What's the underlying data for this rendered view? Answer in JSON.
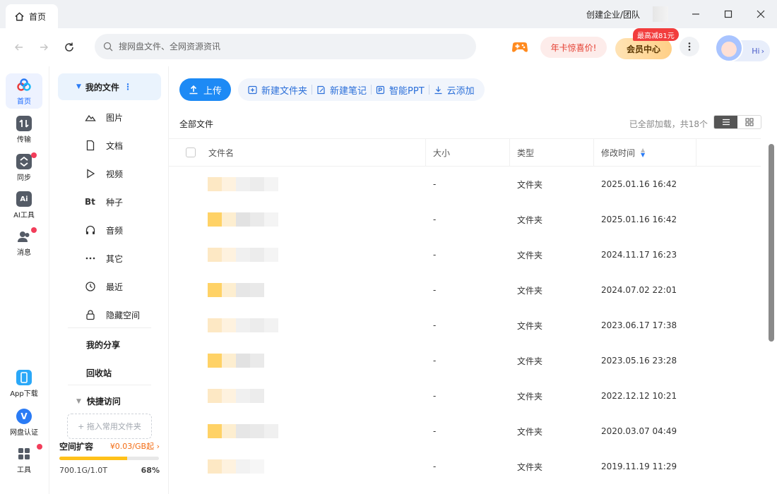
{
  "tab": {
    "title": "首页"
  },
  "titlebar": {
    "enterprise_label": "创建企业/团队"
  },
  "search": {
    "placeholder": "搜网盘文件、全网资源资讯"
  },
  "header": {
    "promo_label": "年卡惊喜价!",
    "vip_label": "会员中心",
    "vip_badge": "最高减81元",
    "hi_label": "Hi"
  },
  "rail": {
    "items": [
      {
        "label": "首页"
      },
      {
        "label": "传输"
      },
      {
        "label": "同步"
      },
      {
        "label": "AI工具"
      },
      {
        "label": "消息"
      }
    ],
    "bottom": [
      {
        "label": "App下载"
      },
      {
        "label": "网盘认证"
      },
      {
        "label": "工具"
      }
    ]
  },
  "categories": {
    "header": "我的文件",
    "items": [
      {
        "label": "图片",
        "icon": "image-icon"
      },
      {
        "label": "文档",
        "icon": "document-icon"
      },
      {
        "label": "视频",
        "icon": "play-icon"
      },
      {
        "label": "种子",
        "icon": "torrent-icon"
      },
      {
        "label": "音频",
        "icon": "headphones-icon"
      },
      {
        "label": "其它",
        "icon": "more-icon"
      },
      {
        "label": "最近",
        "icon": "history-icon"
      },
      {
        "label": "隐藏空间",
        "icon": "lock-icon"
      }
    ],
    "my_share": "我的分享",
    "recycle": "回收站",
    "quick_access": "快捷访问",
    "drop_hint": "+ 拖入常用文件夹"
  },
  "storage": {
    "label": "空间扩容",
    "price": "¥0.03/GB起",
    "used": "700.1G/1.0T",
    "percent_text": "68%",
    "fill_percent": 68
  },
  "toolbar": {
    "upload": "上传",
    "new_folder": "新建文件夹",
    "new_note": "新建笔记",
    "smart_ppt": "智能PPT",
    "cloud_add": "云添加"
  },
  "breadcrumb": "全部文件",
  "loaded_text": "已全部加载，共18个",
  "table": {
    "headers": {
      "name": "文件名",
      "size": "大小",
      "type": "类型",
      "mtime": "修改时间"
    },
    "rows": [
      {
        "size": "-",
        "type": "文件夹",
        "mtime": "2025.01.16 16:42"
      },
      {
        "size": "-",
        "type": "文件夹",
        "mtime": "2025.01.16 16:42"
      },
      {
        "size": "-",
        "type": "文件夹",
        "mtime": "2024.11.17 16:23"
      },
      {
        "size": "-",
        "type": "文件夹",
        "mtime": "2024.07.02 22:01"
      },
      {
        "size": "-",
        "type": "文件夹",
        "mtime": "2023.06.17 17:38"
      },
      {
        "size": "-",
        "type": "文件夹",
        "mtime": "2023.05.16 23:28"
      },
      {
        "size": "-",
        "type": "文件夹",
        "mtime": "2022.12.12 10:21"
      },
      {
        "size": "-",
        "type": "文件夹",
        "mtime": "2020.03.07 04:49"
      },
      {
        "size": "-",
        "type": "文件夹",
        "mtime": "2019.11.19 11:29"
      }
    ]
  },
  "colors": {
    "accent": "#1d8af5",
    "badge_red": "#f23d5a",
    "storage_fill": "#ffc11a"
  }
}
